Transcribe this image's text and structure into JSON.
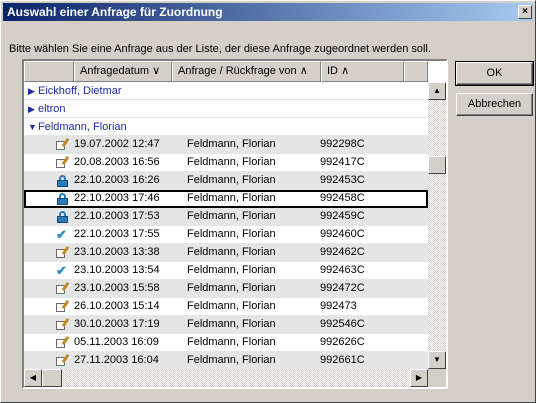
{
  "window": {
    "title": "Auswahl einer Anfrage für Zuordnung",
    "close_glyph": "×"
  },
  "instruction": "Bitte wählen Sie eine Anfrage aus der Liste, der diese Anfrage zugeordnet werden soll.",
  "columns": {
    "date": "Anfragedatum",
    "von": "Anfrage / Rückfrage von",
    "id": "ID"
  },
  "groups": [
    {
      "name": "Eickhoff, Dietmar",
      "state": "collapsed"
    },
    {
      "name": "eltron",
      "state": "collapsed"
    },
    {
      "name": "Feldmann, Florian",
      "state": "expanded"
    }
  ],
  "rows": [
    {
      "icon": "edit-icon",
      "date": "19.07.2002 12:47",
      "von": "Feldmann, Florian",
      "id": "992298C"
    },
    {
      "icon": "edit-icon",
      "date": "20.08.2003 16:56",
      "von": "Feldmann, Florian",
      "id": "992417C"
    },
    {
      "icon": "lock-icon",
      "date": "22.10.2003 16:26",
      "von": "Feldmann, Florian",
      "id": "992453C"
    },
    {
      "icon": "lock-icon",
      "date": "22.10.2003 17:46",
      "von": "Feldmann, Florian",
      "id": "992458C",
      "selected": true
    },
    {
      "icon": "lock-icon",
      "date": "22.10.2003 17:53",
      "von": "Feldmann, Florian",
      "id": "992459C"
    },
    {
      "icon": "check-icon",
      "date": "22.10.2003 17:55",
      "von": "Feldmann, Florian",
      "id": "992460C"
    },
    {
      "icon": "edit-icon",
      "date": "23.10.2003 13:38",
      "von": "Feldmann, Florian",
      "id": "992462C"
    },
    {
      "icon": "check-icon",
      "date": "23.10.2003 13:54",
      "von": "Feldmann, Florian",
      "id": "992463C"
    },
    {
      "icon": "edit-icon",
      "date": "23.10.2003 15:58",
      "von": "Feldmann, Florian",
      "id": "992472C"
    },
    {
      "icon": "edit-icon",
      "date": "26.10.2003 15:14",
      "von": "Feldmann, Florian",
      "id": "992473"
    },
    {
      "icon": "edit-icon",
      "date": "30.10.2003 17:19",
      "von": "Feldmann, Florian",
      "id": "992546C"
    },
    {
      "icon": "edit-icon",
      "date": "05.11.2003 16:09",
      "von": "Feldmann, Florian",
      "id": "992626C"
    },
    {
      "icon": "edit-icon",
      "date": "27.11.2003 16:04",
      "von": "Feldmann, Florian",
      "id": "992661C"
    }
  ],
  "buttons": {
    "ok": "OK",
    "cancel": "Abbrechen"
  },
  "colors": {
    "titlebar": "#0a246a",
    "group_text": "#1c2ba8",
    "row_alt": "#e5e5e5"
  }
}
